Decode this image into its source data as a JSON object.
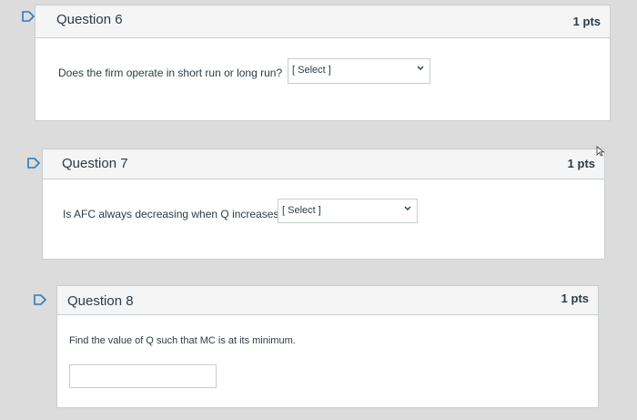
{
  "questions": [
    {
      "title": "Question 6",
      "points": "1 pts",
      "text": "Does the firm operate in short run or long run?",
      "answer_type": "select",
      "select_value": "[ Select ]"
    },
    {
      "title": "Question 7",
      "points": "1 pts",
      "text": "Is AFC always decreasing when Q increases?",
      "answer_type": "select",
      "select_value": "[ Select ]"
    },
    {
      "title": "Question 8",
      "points": "1 pts",
      "text": "Find the value of Q such that MC is at its minimum.",
      "answer_type": "text",
      "input_value": ""
    }
  ],
  "icons": {
    "flag": "bookmark-flag-icon",
    "dropdown": "chevron-down-icon",
    "cursor": "mouse-pointer-icon"
  },
  "colors": {
    "flag_stroke": "#2b7abc",
    "border": "#c7cdd1",
    "header_bg": "#f5f5f5",
    "text": "#2d3b45"
  }
}
